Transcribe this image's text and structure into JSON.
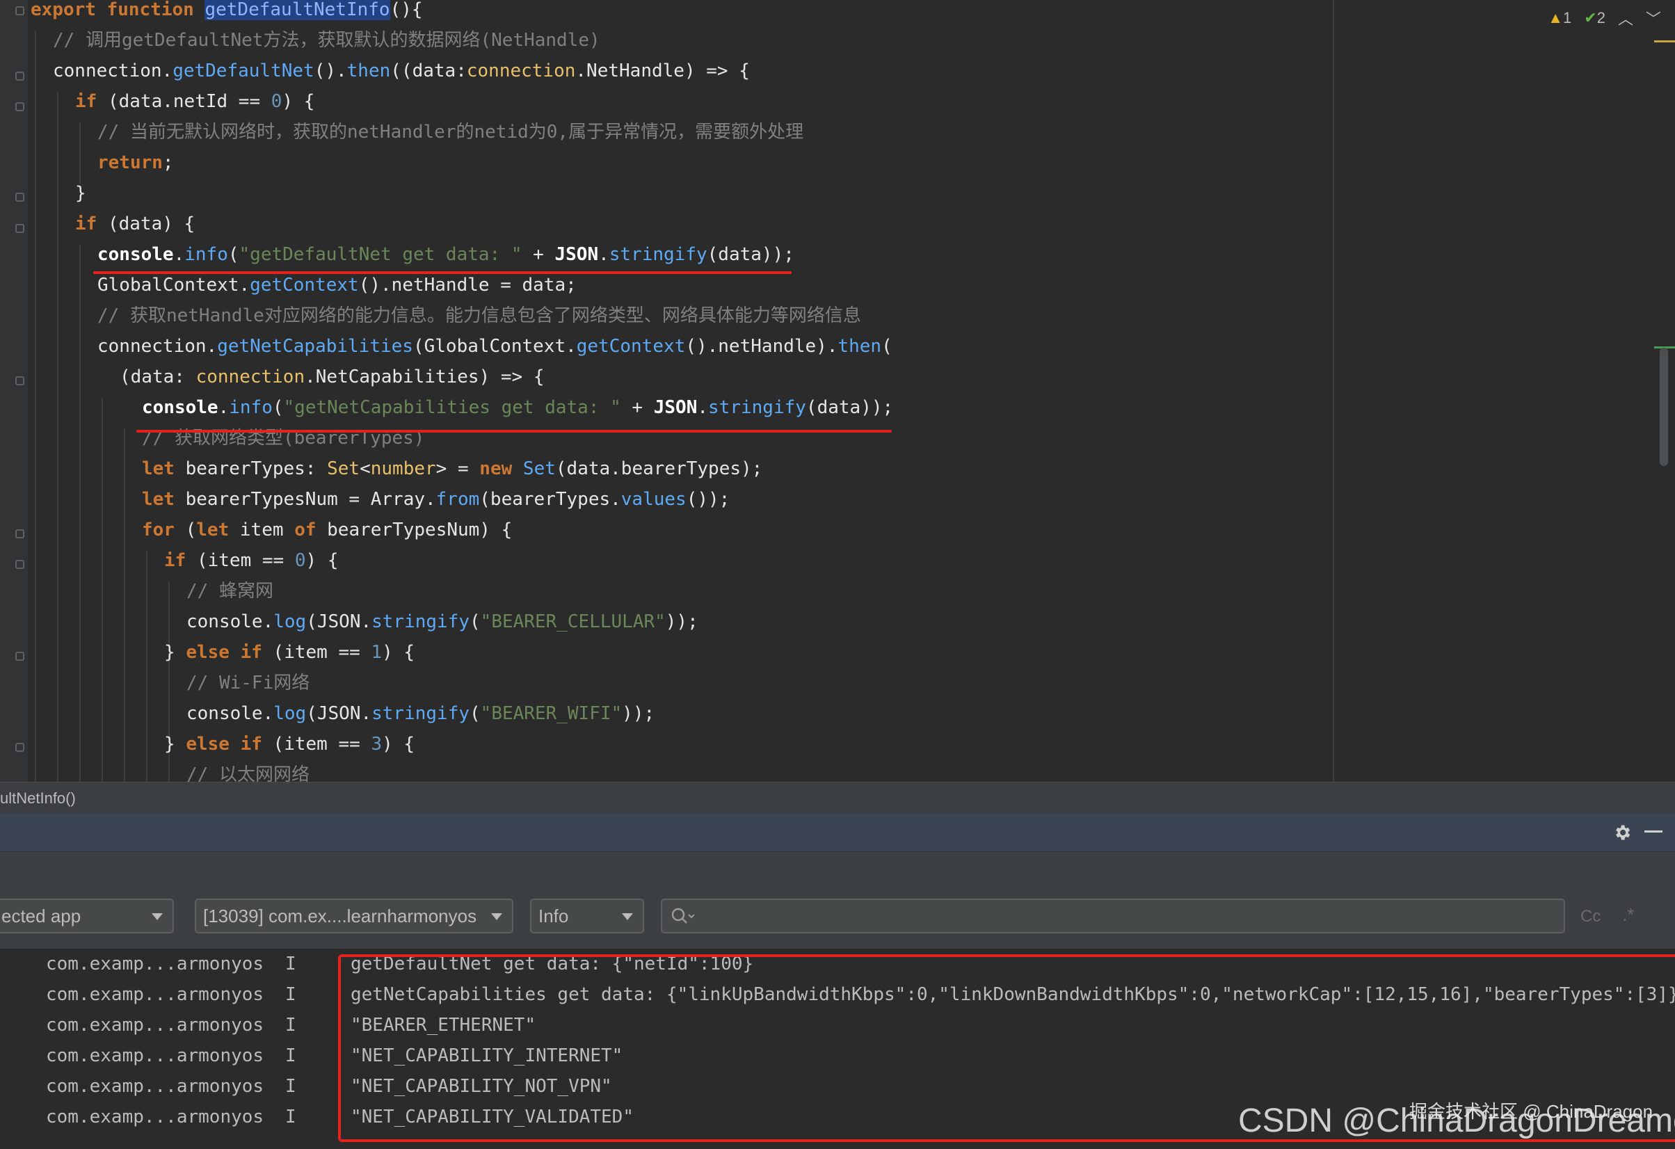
{
  "editor": {
    "inspector": {
      "warnings": "1",
      "weak_warnings": "2"
    },
    "lines": [
      [
        [
          "kw",
          "export "
        ],
        [
          "kw",
          "function "
        ],
        [
          "hl",
          "getDefaultNetInfo"
        ],
        [
          "pl",
          "(){"
        ]
      ],
      [
        [
          "cm",
          "// 调用getDefaultNet方法，获取默认的数据网络(NetHandle)"
        ]
      ],
      [
        [
          "pl",
          "connection."
        ],
        [
          "mt",
          "getDefaultNet"
        ],
        [
          "pl",
          "()."
        ],
        [
          "mt",
          "then"
        ],
        [
          "pl",
          "((data:"
        ],
        [
          "ty",
          "connection"
        ],
        [
          "pl",
          ".NetHandle) => {"
        ]
      ],
      [
        [
          "kw",
          "if "
        ],
        [
          "pl",
          "(data.netId == "
        ],
        [
          "nm",
          "0"
        ],
        [
          "pl",
          ") {"
        ]
      ],
      [
        [
          "cm",
          "// 当前无默认网络时，获取的netHandler的netid为0,属于异常情况，需要额外处理"
        ]
      ],
      [
        [
          "kw",
          "return"
        ],
        [
          "pl",
          ";"
        ]
      ],
      [
        [
          "pl",
          "}"
        ]
      ],
      [
        [
          "kw",
          "if "
        ],
        [
          "pl",
          "(data) {"
        ]
      ],
      [
        [
          "wh",
          "console"
        ],
        [
          "pl",
          "."
        ],
        [
          "mt",
          "info"
        ],
        [
          "pl",
          "("
        ],
        [
          "st",
          "\"getDefaultNet get data: \""
        ],
        [
          "pl",
          " + "
        ],
        [
          "wh",
          "JSON"
        ],
        [
          "pl",
          "."
        ],
        [
          "mt",
          "stringify"
        ],
        [
          "pl",
          "(data));"
        ]
      ],
      [
        [
          "pl",
          "GlobalContext."
        ],
        [
          "mt",
          "getContext"
        ],
        [
          "pl",
          "().netHandle = data;"
        ]
      ],
      [
        [
          "cm",
          "// 获取netHandle对应网络的能力信息。能力信息包含了网络类型、网络具体能力等网络信息"
        ]
      ],
      [
        [
          "pl",
          "connection."
        ],
        [
          "mt",
          "getNetCapabilities"
        ],
        [
          "pl",
          "(GlobalContext."
        ],
        [
          "mt",
          "getContext"
        ],
        [
          "pl",
          "().netHandle)."
        ],
        [
          "mt",
          "then"
        ],
        [
          "pl",
          "("
        ]
      ],
      [
        [
          "pl",
          "(data: "
        ],
        [
          "ty",
          "connection"
        ],
        [
          "pl",
          ".NetCapabilities) => {"
        ]
      ],
      [
        [
          "wh",
          "console"
        ],
        [
          "pl",
          "."
        ],
        [
          "mt",
          "info"
        ],
        [
          "pl",
          "("
        ],
        [
          "st",
          "\"getNetCapabilities get data: \""
        ],
        [
          "pl",
          " + "
        ],
        [
          "wh",
          "JSON"
        ],
        [
          "pl",
          "."
        ],
        [
          "mt",
          "stringify"
        ],
        [
          "pl",
          "(data));"
        ]
      ],
      [
        [
          "cm",
          "// 获取网络类型(bearerTypes)"
        ]
      ],
      [
        [
          "kw",
          "let "
        ],
        [
          "pl",
          "bearerTypes: "
        ],
        [
          "ty",
          "Set"
        ],
        [
          "pl",
          "<"
        ],
        [
          "ty",
          "number"
        ],
        [
          "pl",
          "> = "
        ],
        [
          "kw",
          "new "
        ],
        [
          "mt",
          "Set"
        ],
        [
          "pl",
          "(data.bearerTypes);"
        ]
      ],
      [
        [
          "kw",
          "let "
        ],
        [
          "pl",
          "bearerTypesNum = Array."
        ],
        [
          "mt",
          "from"
        ],
        [
          "pl",
          "(bearerTypes."
        ],
        [
          "mt",
          "values"
        ],
        [
          "pl",
          "());"
        ]
      ],
      [
        [
          "kw",
          "for "
        ],
        [
          "pl",
          "("
        ],
        [
          "kw",
          "let "
        ],
        [
          "pl",
          "item "
        ],
        [
          "kw",
          "of "
        ],
        [
          "pl",
          "bearerTypesNum) {"
        ]
      ],
      [
        [
          "kw",
          "if "
        ],
        [
          "pl",
          "(item == "
        ],
        [
          "nm",
          "0"
        ],
        [
          "pl",
          ") {"
        ]
      ],
      [
        [
          "cm",
          "// 蜂窝网"
        ]
      ],
      [
        [
          "pl",
          "console."
        ],
        [
          "mt",
          "log"
        ],
        [
          "pl",
          "(JSON."
        ],
        [
          "mt",
          "stringify"
        ],
        [
          "pl",
          "("
        ],
        [
          "st",
          "\"BEARER_CELLULAR\""
        ],
        [
          "pl",
          "));"
        ]
      ],
      [
        [
          "pl",
          "} "
        ],
        [
          "kw",
          "else if "
        ],
        [
          "pl",
          "(item == "
        ],
        [
          "nm",
          "1"
        ],
        [
          "pl",
          ") {"
        ]
      ],
      [
        [
          "cm",
          "// Wi-Fi网络"
        ]
      ],
      [
        [
          "pl",
          "console."
        ],
        [
          "mt",
          "log"
        ],
        [
          "pl",
          "(JSON."
        ],
        [
          "mt",
          "stringify"
        ],
        [
          "pl",
          "("
        ],
        [
          "st",
          "\"BEARER_WIFI\""
        ],
        [
          "pl",
          "));"
        ]
      ],
      [
        [
          "pl",
          "} "
        ],
        [
          "kw",
          "else if "
        ],
        [
          "pl",
          "(item == "
        ],
        [
          "nm",
          "3"
        ],
        [
          "pl",
          ") {"
        ]
      ],
      [
        [
          "cm",
          "// 以太网网络"
        ]
      ]
    ]
  },
  "breadcrumb": {
    "text": "ultNetInfo()"
  },
  "logcat": {
    "device_select": "ected app",
    "process_select": "[13039] com.ex....learnharmonyos",
    "level_select": "Info",
    "search_placeholder": "",
    "case_toggle": "Cc",
    "regex_toggle": ".*",
    "rows": [
      {
        "tag": "com.examp...armonyos",
        "level": "I",
        "message": "getDefaultNet get data: {\"netId\":100}"
      },
      {
        "tag": "com.examp...armonyos",
        "level": "I",
        "message": "getNetCapabilities get data: {\"linkUpBandwidthKbps\":0,\"linkDownBandwidthKbps\":0,\"networkCap\":[12,15,16],\"bearerTypes\":[3]}"
      },
      {
        "tag": "com.examp...armonyos",
        "level": "I",
        "message": "\"BEARER_ETHERNET\""
      },
      {
        "tag": "com.examp...armonyos",
        "level": "I",
        "message": "\"NET_CAPABILITY_INTERNET\""
      },
      {
        "tag": "com.examp...armonyos",
        "level": "I",
        "message": "\"NET_CAPABILITY_NOT_VPN\""
      },
      {
        "tag": "com.examp...armonyos",
        "level": "I",
        "message": "\"NET_CAPABILITY_VALIDATED\""
      }
    ]
  },
  "watermark": {
    "small": "掘金技术社区 @ ChinaDragon",
    "large": "CSDN @ChinaDragonDreamer"
  },
  "colors": {
    "annotation_red": "#e5231e",
    "keyword": "#cc7832",
    "string": "#6a8759",
    "method": "#5eaaf5"
  }
}
